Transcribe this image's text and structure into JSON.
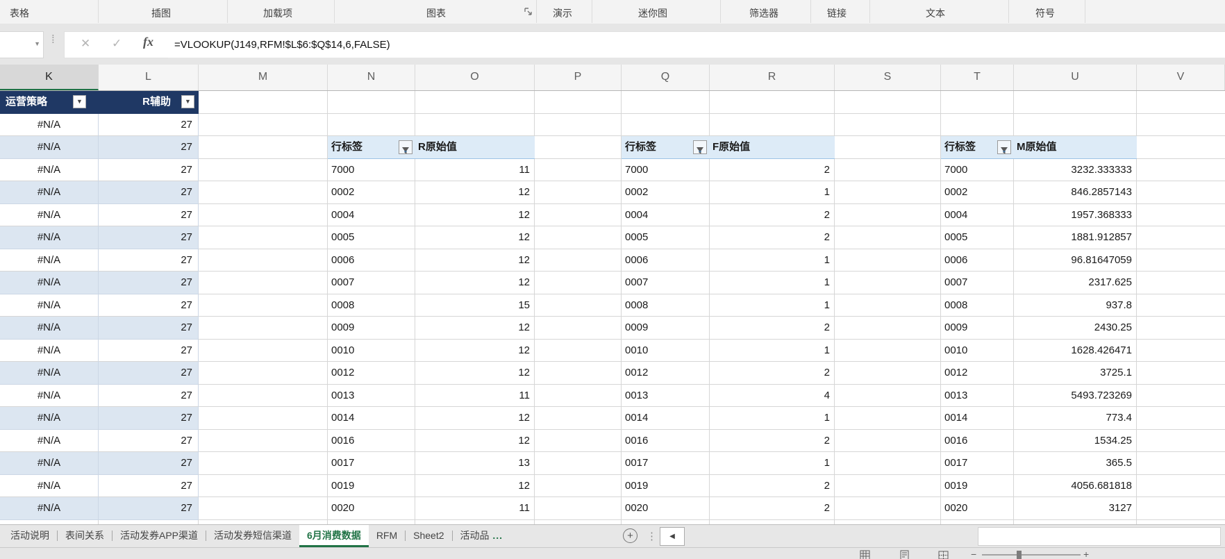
{
  "ribbon": {
    "groups": [
      {
        "label": "表格"
      },
      {
        "label": "插图"
      },
      {
        "label": "加载项"
      },
      {
        "label": "图表"
      },
      {
        "label": "演示"
      },
      {
        "label": "迷你图"
      },
      {
        "label": "筛选器"
      },
      {
        "label": "链接"
      },
      {
        "label": "文本"
      },
      {
        "label": "符号"
      }
    ]
  },
  "formula_bar": {
    "name_box_value": "",
    "name_dropdown_glyph": "▼",
    "cancel_glyph": "✕",
    "enter_glyph": "✓",
    "fx_label": "fx",
    "formula": "=VLOOKUP(J149,RFM!$L$6:$Q$14,6,FALSE)"
  },
  "grid": {
    "column_letters": [
      "K",
      "L",
      "M",
      "N",
      "O",
      "P",
      "Q",
      "R",
      "S",
      "T",
      "U",
      "V"
    ],
    "selected_column": "K"
  },
  "kl_table": {
    "column1_header": "运营策略",
    "column2_header": "R辅助",
    "filter_glyph": "▼",
    "row_count": 18,
    "error_value": "#N/A",
    "helper_value": "27"
  },
  "pivots": [
    {
      "row_label": "行标签",
      "value_label": "R原始值",
      "labels": [
        "7000",
        "0002",
        "0004",
        "0005",
        "0006",
        "0007",
        "0008",
        "0009",
        "0010",
        "0012",
        "0013",
        "0014",
        "0016",
        "0017",
        "0019",
        "0020"
      ],
      "values": [
        "11",
        "12",
        "12",
        "12",
        "12",
        "12",
        "15",
        "12",
        "12",
        "12",
        "11",
        "12",
        "12",
        "13",
        "12",
        "11"
      ]
    },
    {
      "row_label": "行标签",
      "value_label": "F原始值",
      "labels": [
        "7000",
        "0002",
        "0004",
        "0005",
        "0006",
        "0007",
        "0008",
        "0009",
        "0010",
        "0012",
        "0013",
        "0014",
        "0016",
        "0017",
        "0019",
        "0020"
      ],
      "values": [
        "2",
        "1",
        "2",
        "2",
        "1",
        "1",
        "1",
        "2",
        "1",
        "2",
        "4",
        "1",
        "2",
        "1",
        "2",
        "2"
      ]
    },
    {
      "row_label": "行标签",
      "value_label": "M原始值",
      "labels": [
        "7000",
        "0002",
        "0004",
        "0005",
        "0006",
        "0007",
        "0008",
        "0009",
        "0010",
        "0012",
        "0013",
        "0014",
        "0016",
        "0017",
        "0019",
        "0020"
      ],
      "values": [
        "3232.333333",
        "846.2857143",
        "1957.368333",
        "1881.912857",
        "96.81647059",
        "2317.625",
        "937.8",
        "2430.25",
        "1628.426471",
        "3725.1",
        "5493.723269",
        "773.4",
        "1534.25",
        "365.5",
        "4056.681818",
        "3127"
      ]
    }
  ],
  "sheet_tabs": {
    "tabs": [
      {
        "label": "活动说明",
        "active": false,
        "truncated": false
      },
      {
        "label": "表间关系",
        "active": false,
        "truncated": false
      },
      {
        "label": "活动发券APP渠道",
        "active": false,
        "truncated": false
      },
      {
        "label": "活动发券短信渠道",
        "active": false,
        "truncated": false
      },
      {
        "label": "6月消费数据",
        "active": true,
        "truncated": false
      },
      {
        "label": "RFM",
        "active": false,
        "truncated": false
      },
      {
        "label": "Sheet2",
        "active": false,
        "truncated": false
      },
      {
        "label": "活动品",
        "active": false,
        "truncated": true
      }
    ],
    "truncation_dots": "...",
    "add_label": "+",
    "more_dots": "⋮",
    "scroll_left_glyph": "◀"
  },
  "status_bar": {
    "zoom_out_glyph": "−",
    "zoom_in_glyph": "+"
  }
}
